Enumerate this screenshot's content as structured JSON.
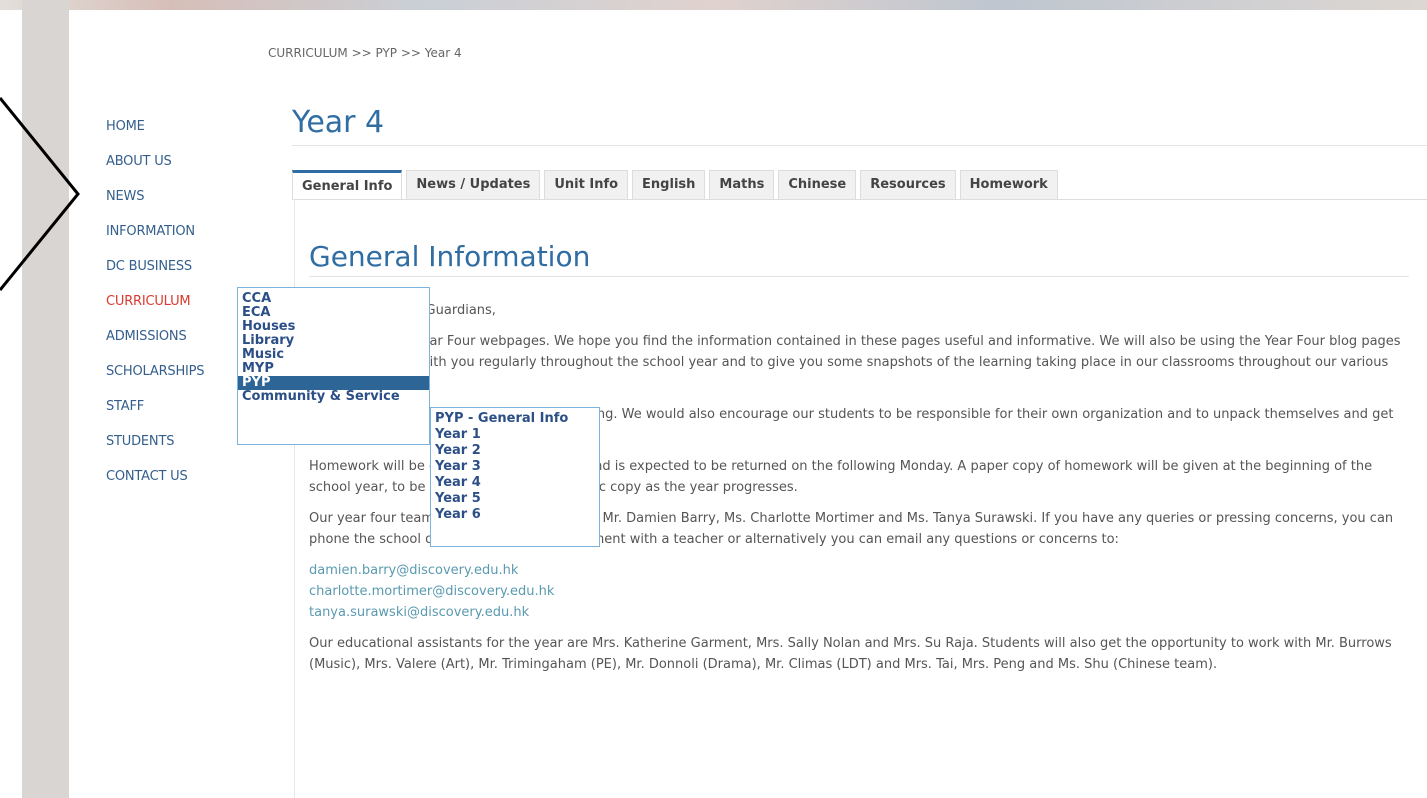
{
  "breadcrumb": "CURRICULUM >> PYP >> Year 4",
  "nav": {
    "items": [
      {
        "label": "HOME"
      },
      {
        "label": "ABOUT US"
      },
      {
        "label": "NEWS"
      },
      {
        "label": "INFORMATION"
      },
      {
        "label": "DC BUSINESS"
      },
      {
        "label": "CURRICULUM"
      },
      {
        "label": "ADMISSIONS"
      },
      {
        "label": "SCHOLARSHIPS"
      },
      {
        "label": "STAFF"
      },
      {
        "label": "STUDENTS"
      },
      {
        "label": "CONTACT US"
      }
    ],
    "active_color": "#d93a2f",
    "link_color": "#345f8c"
  },
  "page_title": "Year 4",
  "tabs": [
    {
      "label": "General Info"
    },
    {
      "label": "News / Updates"
    },
    {
      "label": "Unit Info"
    },
    {
      "label": "English"
    },
    {
      "label": "Maths"
    },
    {
      "label": "Chinese"
    },
    {
      "label": "Resources"
    },
    {
      "label": "Homework"
    }
  ],
  "section_title": "General Information",
  "content": {
    "p1": "Dear Parents and Guardians,",
    "p2": "Welcome to the Year Four webpages. We hope you find the information contained in these pages useful and informative. We will also be using the Year Four blog pages to communicate with you regularly throughout the school year and to give you some snapshots of the learning taking place in our classrooms throughout our various units of inquiry.",
    "p3": "Students will begin class at 8.25 each morning. We would also encourage our students to be responsible for their own organization and to unpack themselves and get themselves ready for class in the mornings.",
    "p4": "Homework will be distributed on Mondays and is expected to be returned on the following Monday. A paper copy of homework will be given at the beginning of the school year, to be replaced with an electronic copy as the year progresses.",
    "p5": "Our year four team this year is comprised of Mr. Damien Barry, Ms. Charlotte Mortimer and Ms. Tanya Surawski. If you have any queries or pressing concerns, you can phone the school office to make an appointment with a teacher or alternatively you can email any questions or concerns to:",
    "emails": [
      "damien.barry@discovery.edu.hk",
      "charlotte.mortimer@discovery.edu.hk",
      "tanya.surawski@discovery.edu.hk"
    ],
    "p6": "Our educational assistants for the year are Mrs. Katherine Garment, Mrs. Sally Nolan and Mrs. Su Raja. Students will also get the opportunity to work with Mr. Burrows (Music), Mrs. Valere (Art), Mr. Trimingaham (PE), Mr. Donnoli (Drama), Mr. Climas (LDT) and Mrs. Tai, Mrs. Peng and Ms. Shu (Chinese team)."
  },
  "dropdown": {
    "items": [
      "CCA",
      "ECA",
      "Houses",
      "Library",
      "Music",
      "MYP",
      "PYP",
      "Community & Service"
    ],
    "selected": "PYP"
  },
  "submenu": {
    "items": [
      "PYP - General Info",
      "Year 1",
      "Year 2",
      "Year 3",
      "Year 4",
      "Year 5",
      "Year 6"
    ]
  },
  "icons": {
    "arrow": "chevron-right-icon"
  }
}
